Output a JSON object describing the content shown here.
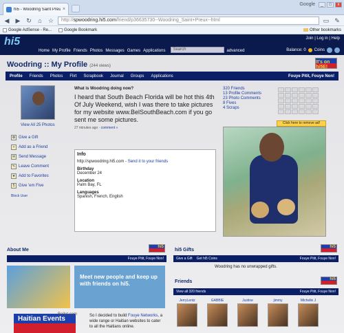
{
  "browser": {
    "tab_title": "hi5 - Woodring Saint Preux",
    "brand": "Google",
    "url_domain": "spwoodring.hi5.com",
    "url_path": "/friend/p36635730--Woodring_Saint+Preux--html",
    "url_prefix": "http://",
    "bookmarks": [
      "Google AdSense - Re...",
      "Google Bookmark"
    ],
    "other_bookmarks": "Other bookmarks"
  },
  "hi5": {
    "logo": "hi5",
    "nav": [
      "Home",
      "My Profile",
      "Friends",
      "Photos",
      "Messages",
      "Games",
      "Applications"
    ],
    "search_placeholder": "Search",
    "advanced": "advanced",
    "top_links": "Join | Log in | Help",
    "balance_label": "Balance: 0",
    "coins_label": "Coins"
  },
  "profile": {
    "title": "Woodring :: My Profile",
    "views": "(244 views)",
    "flag_text": "It's on hi5E!",
    "tabs": [
      "Profile",
      "Friends",
      "Photos",
      "Flirt",
      "Scrapbook",
      "Journal",
      "Groups",
      "Applications"
    ],
    "slogan": "Fouye Pitit, Fouye Non!",
    "view_all_photos": "View All 25 Photos",
    "actions": [
      "Give a Gift",
      "Add as a Friend",
      "Send Message",
      "Leave Comment",
      "Add to Favorites",
      "Give 'em Five"
    ],
    "block_user": "Block User",
    "doing_question": "What is Woodring doing now?",
    "doing_message": "I heard that South Beach Florida will be hot this 4th Of July Weekend, wish I was there to take pictures for my website www.BelSouthBeach.com if you go sent me some pictures.",
    "doing_meta": "27 minutes ago",
    "doing_comment": "comment »",
    "info_title": "Info",
    "info_url": "http://spwoodring.hi5.com",
    "info_send": "Send it to your friends",
    "birthday_label": "Birthday",
    "birthday": "December 24",
    "location_label": "Location",
    "location": "Palm Bay, FL",
    "languages_label": "Languages",
    "languages": "Spanish, French, English",
    "stats": [
      "320 Friends",
      "13 Profile Comments",
      "23 Photo Comments",
      "8 Fives",
      "4 Scraps"
    ],
    "click_remove": "Click here to remove ad!"
  },
  "about": {
    "heading": "About Me",
    "meet_text": "Meet new people and keep up with friends on hi5.",
    "haiti_text": "Haitian Events",
    "bellet": "Bellet.com",
    "about_text_1": "So I decided to build ",
    "about_link": "Fouye Networks",
    "about_text_2": ", a wide range or Haitian websites to cater to all the Haitians online."
  },
  "gifts": {
    "heading": "hi5 Gifts",
    "give_gift": "Give a Gift",
    "get_coins": "Get hi5 Coins",
    "none": "Woodring has no unwrapped gifts."
  },
  "friends": {
    "heading": "Friends",
    "view_all": "View all 320 friends",
    "names": [
      "JerryLentz",
      "GABBIE",
      "Justine",
      "jimmy",
      "Michelle J"
    ]
  }
}
